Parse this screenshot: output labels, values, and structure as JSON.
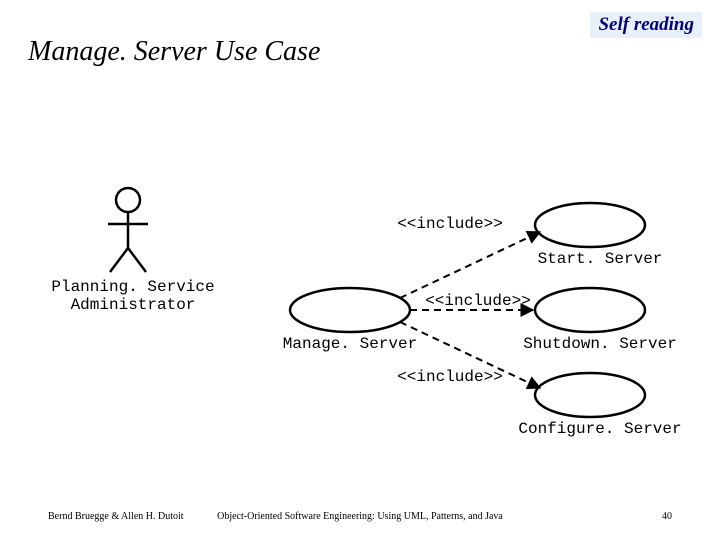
{
  "header": {
    "badge": "Self reading",
    "title": "Manage. Server Use Case"
  },
  "actor": {
    "name_line1": "Planning. Service",
    "name_line2": "Administrator"
  },
  "usecases": {
    "manage": "Manage. Server",
    "start": "Start. Server",
    "shutdown": "Shutdown. Server",
    "configure": "Configure. Server"
  },
  "stereotype": {
    "include1": "<<include>>",
    "include2": "<<include>>",
    "include3": "<<include>>"
  },
  "footer": {
    "left": "Bernd Bruegge & Allen H. Dutoit",
    "center": "Object-Oriented Software Engineering: Using UML, Patterns, and Java",
    "right": "40"
  }
}
